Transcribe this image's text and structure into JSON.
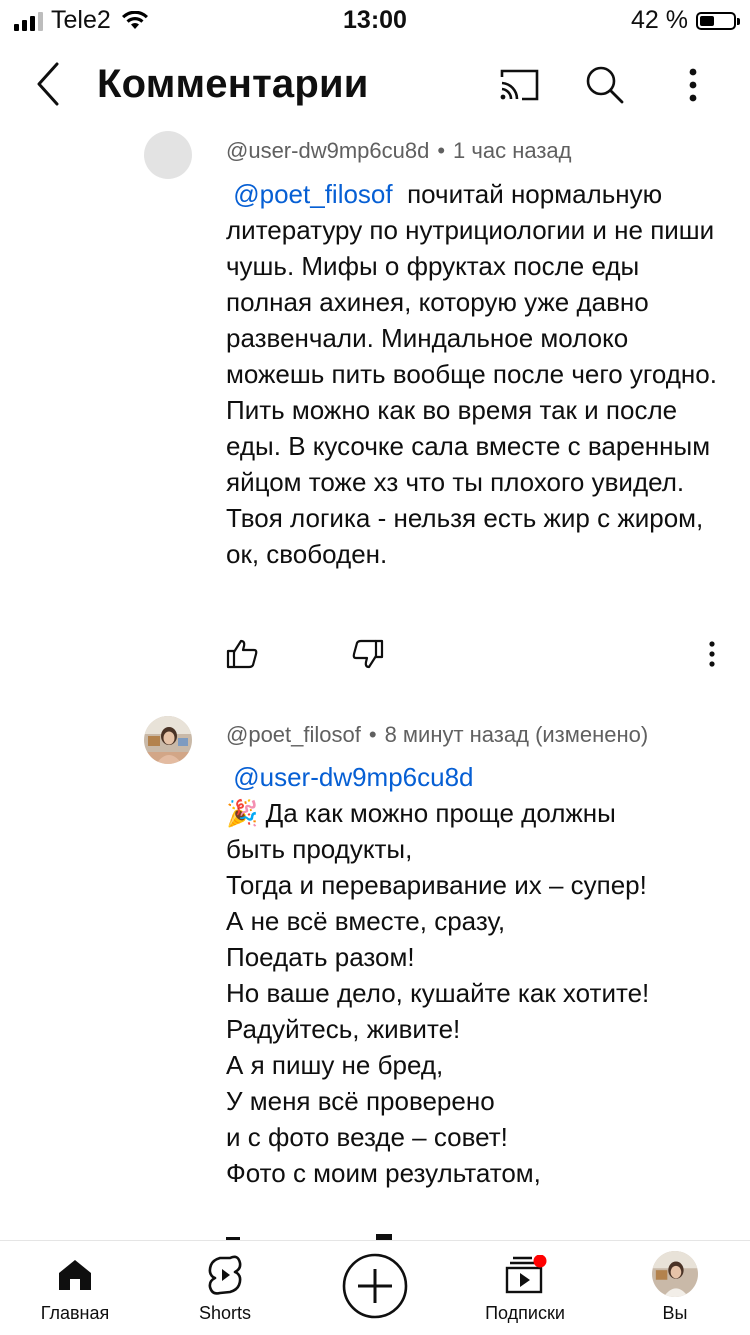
{
  "status_bar": {
    "carrier": "Tele2",
    "time": "13:00",
    "battery": "42 %"
  },
  "header": {
    "title": "Комментарии",
    "icons": [
      "back-icon",
      "cast-icon",
      "search-icon",
      "more-vertical-icon"
    ]
  },
  "comments": [
    {
      "author": "@user-dw9mp6cu8d",
      "separator": "•",
      "time": "1 час назад",
      "mention": "@poet_filosof",
      "text": "почитай нормальную литературу по нутрициологии и не пиши чушь. Мифы о фруктах после еды полная ахинея, которую уже давно развенчали. Миндальное молоко можешь пить вообще после чего угодно. Пить можно как во время так и после еды. В кусочке сала вместе с варенным яйцом тоже хз что ты плохого увидел. Твоя логика - нельзя есть жир с жиром, ок, свободен.",
      "actions": [
        "like-icon",
        "dislike-icon",
        "more-vertical-icon"
      ]
    },
    {
      "author": "@poet_filosof",
      "separator": "•",
      "time": "8 минут назад (изменено)",
      "mention": "@user-dw9mp6cu8d",
      "emoji": "🎉",
      "lines": [
        "Да как можно проще должны",
        "быть продукты,",
        "Тогда и переваривание их – супер!",
        "А не всё вместе, сразу,",
        "Поедать разом!",
        "Но ваше дело, кушайте как хотите!",
        "Радуйтесь, живите!",
        "А я пишу не бред,",
        "У меня всё проверено",
        "и с фото везде – совет!",
        "Фото с моим результатом,"
      ]
    }
  ],
  "bottom_nav": [
    {
      "label": "Главная",
      "icon": "home-icon"
    },
    {
      "label": "Shorts",
      "icon": "shorts-icon"
    },
    {
      "label": "",
      "icon": "create-icon"
    },
    {
      "label": "Подписки",
      "icon": "subscriptions-icon"
    },
    {
      "label": "Вы",
      "icon": "profile-avatar"
    }
  ],
  "colors": {
    "mention": "#065fd4",
    "meta": "#606060",
    "notification_dot": "#ff0000"
  }
}
